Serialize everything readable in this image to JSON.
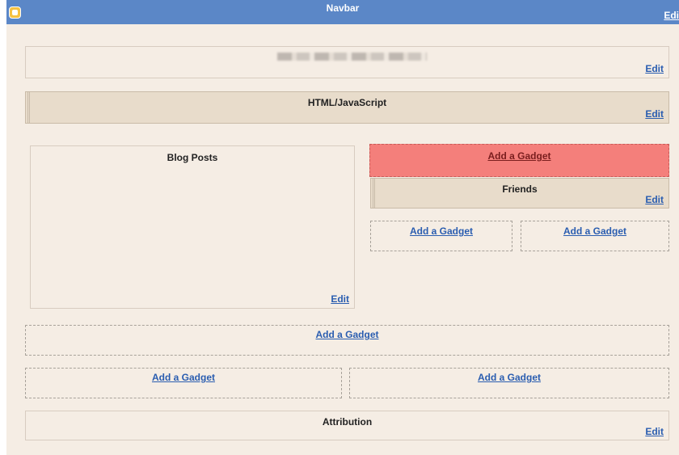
{
  "navbar": {
    "title": "Navbar",
    "edit_label": "Edit"
  },
  "header": {
    "edit_label": "Edit"
  },
  "html_js": {
    "title": "HTML/JavaScript",
    "edit_label": "Edit"
  },
  "blog_posts": {
    "title": "Blog Posts",
    "edit_label": "Edit"
  },
  "sidebar": {
    "add_gadget_top": "Add a Gadget",
    "friends": {
      "title": "Friends",
      "edit_label": "Edit"
    },
    "add_gadget_left": "Add a Gadget",
    "add_gadget_right": "Add a Gadget"
  },
  "footer": {
    "add_gadget_full": "Add a Gadget",
    "add_gadget_left": "Add a Gadget",
    "add_gadget_right": "Add a Gadget"
  },
  "attribution": {
    "title": "Attribution",
    "edit_label": "Edit"
  },
  "colors": {
    "navbar": "#5b87c7",
    "canvas": "#f5ede4",
    "active_gadget": "#f47f7b",
    "link": "#2a5db0"
  },
  "icons": {
    "navbar_logo": "blogger-logo-icon"
  }
}
